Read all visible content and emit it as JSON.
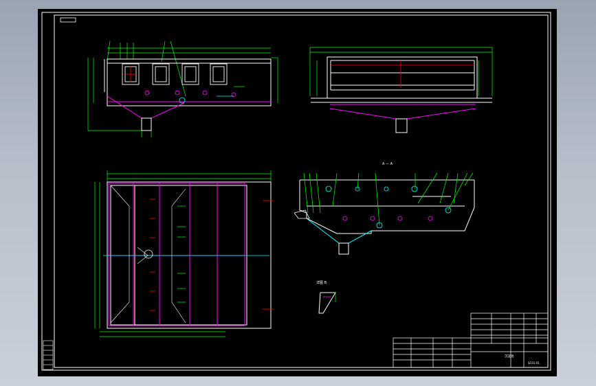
{
  "drawing": {
    "section_label": "A — A",
    "detail_label": "详图 B",
    "title_text": "沉淀池",
    "drawing_number": "SC01-01",
    "colors": {
      "background": "#000000",
      "frame": "#ffffff",
      "dimension": "#00ff00",
      "outline": "#ffffff",
      "hopper": "#ff00ff",
      "pipe": "#00ffff",
      "red": "#ff0000"
    }
  }
}
